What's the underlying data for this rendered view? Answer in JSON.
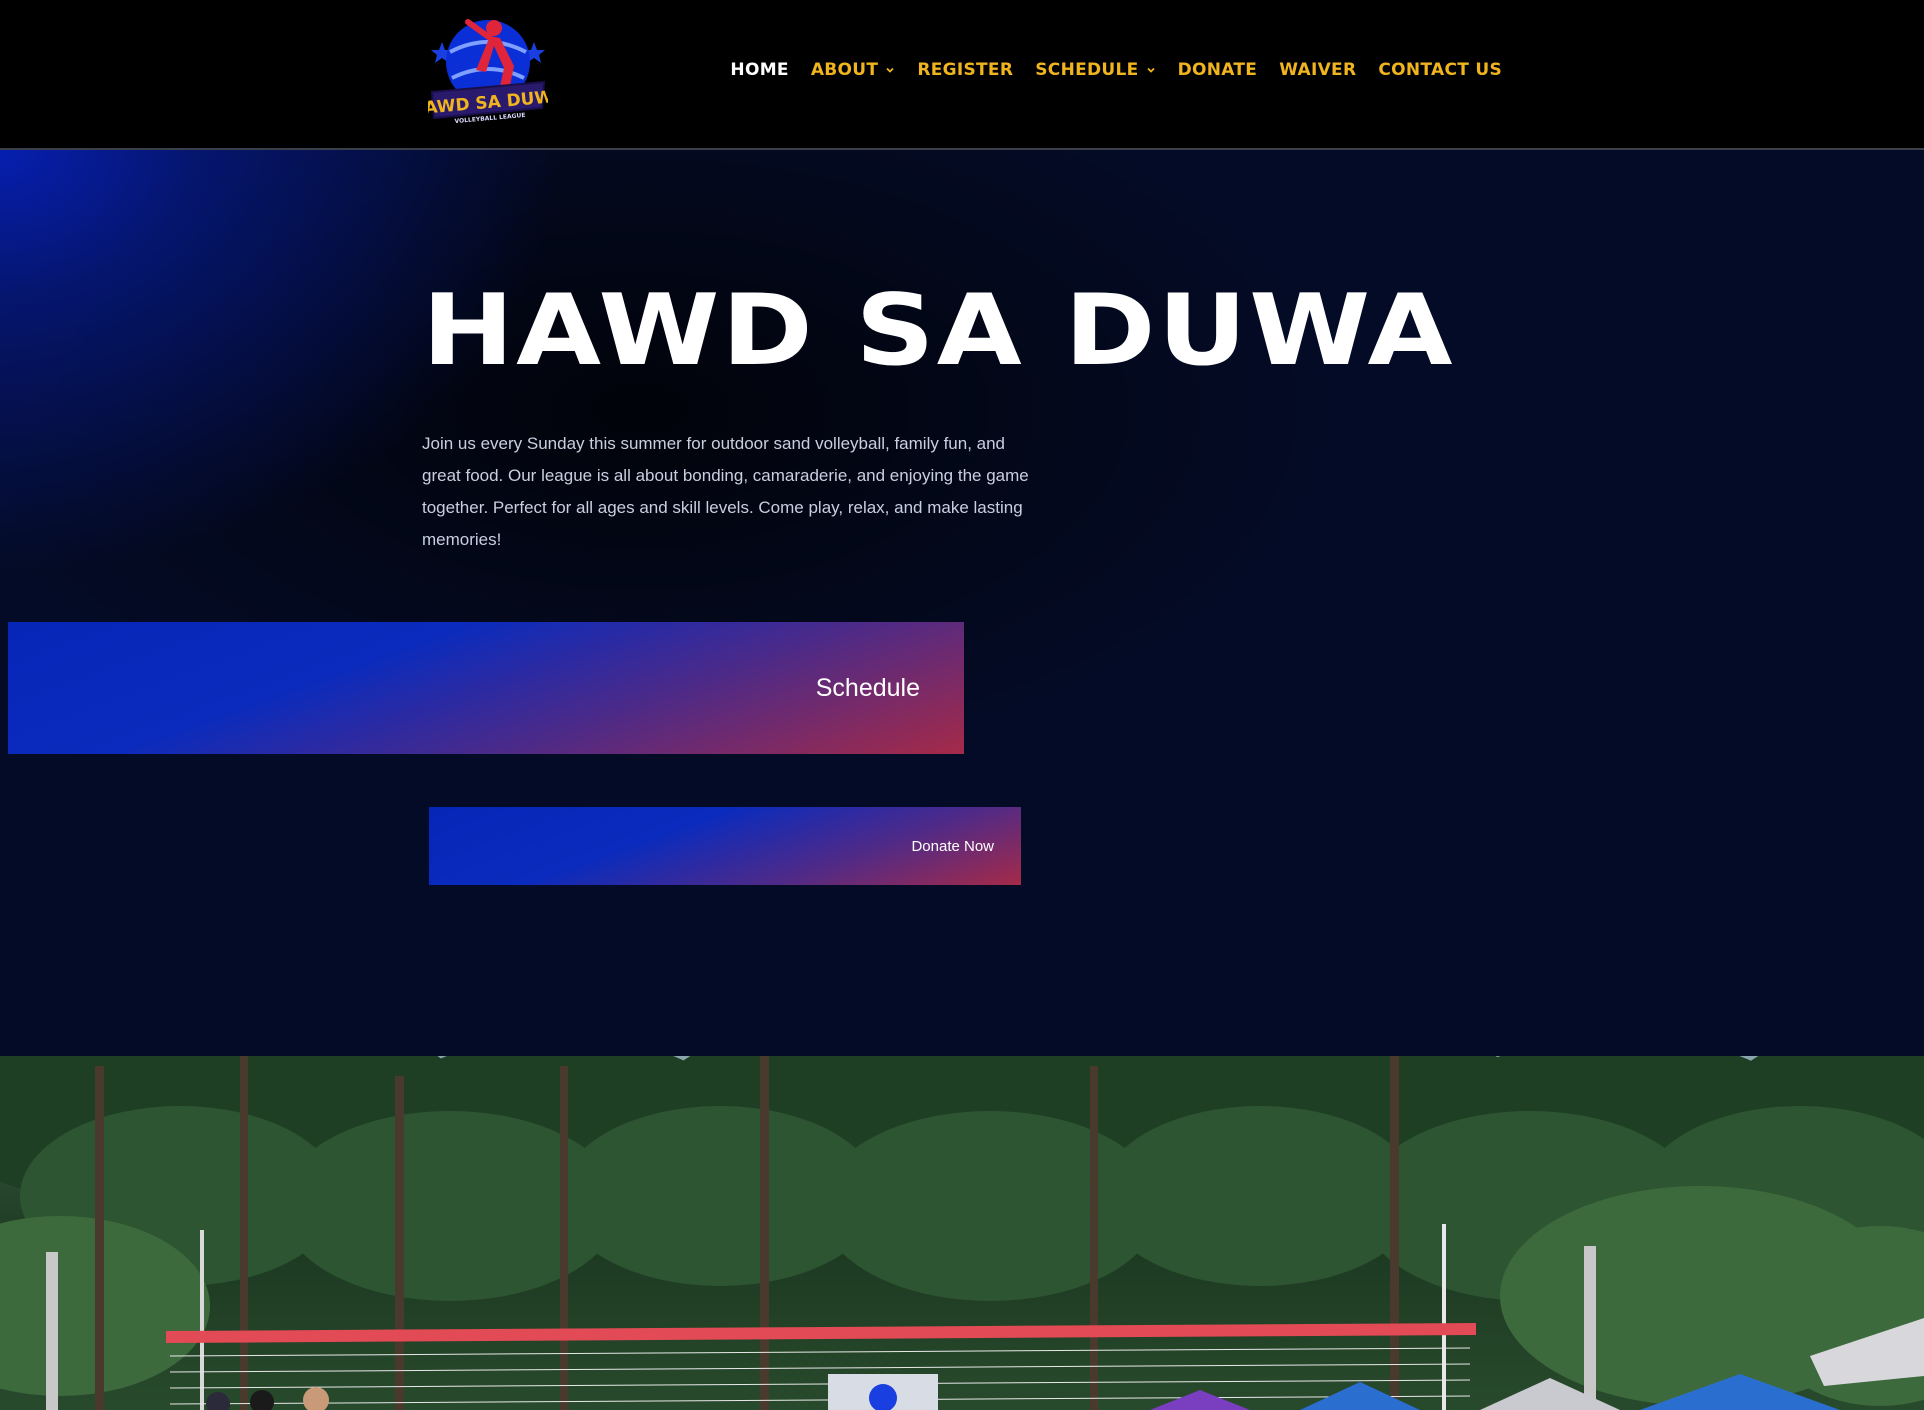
{
  "header": {
    "logo": {
      "text": "HAWD SA DUWA",
      "subtext": "VOLLEYBALL LEAGUE",
      "icon": "volleyball-player-logo"
    },
    "nav": [
      {
        "label": "HOME",
        "active": true,
        "dropdown": false
      },
      {
        "label": "ABOUT",
        "active": false,
        "dropdown": true
      },
      {
        "label": "REGISTER",
        "active": false,
        "dropdown": false
      },
      {
        "label": "SCHEDULE",
        "active": false,
        "dropdown": true
      },
      {
        "label": "DONATE",
        "active": false,
        "dropdown": false
      },
      {
        "label": "WAIVER",
        "active": false,
        "dropdown": false
      },
      {
        "label": "CONTACT US",
        "active": false,
        "dropdown": false
      }
    ]
  },
  "hero": {
    "title": "HAWD SA DUWA",
    "description": "Join us every Sunday this summer for outdoor sand volleyball, family fun, and great food. Our league is all about bonding, camaraderie, and enjoying the game together. Perfect for all ages and skill levels. Come play, relax, and make lasting memories!",
    "schedule_button": "Schedule",
    "donate_button": "Donate Now"
  },
  "photo": {
    "subject": "volleyball-court-photo"
  },
  "colors": {
    "nav_link": "#f0b41f",
    "nav_active": "#ffffff",
    "hero_bg": "#040b26",
    "button_start": "#0626b8",
    "button_end": "#a52a48"
  }
}
